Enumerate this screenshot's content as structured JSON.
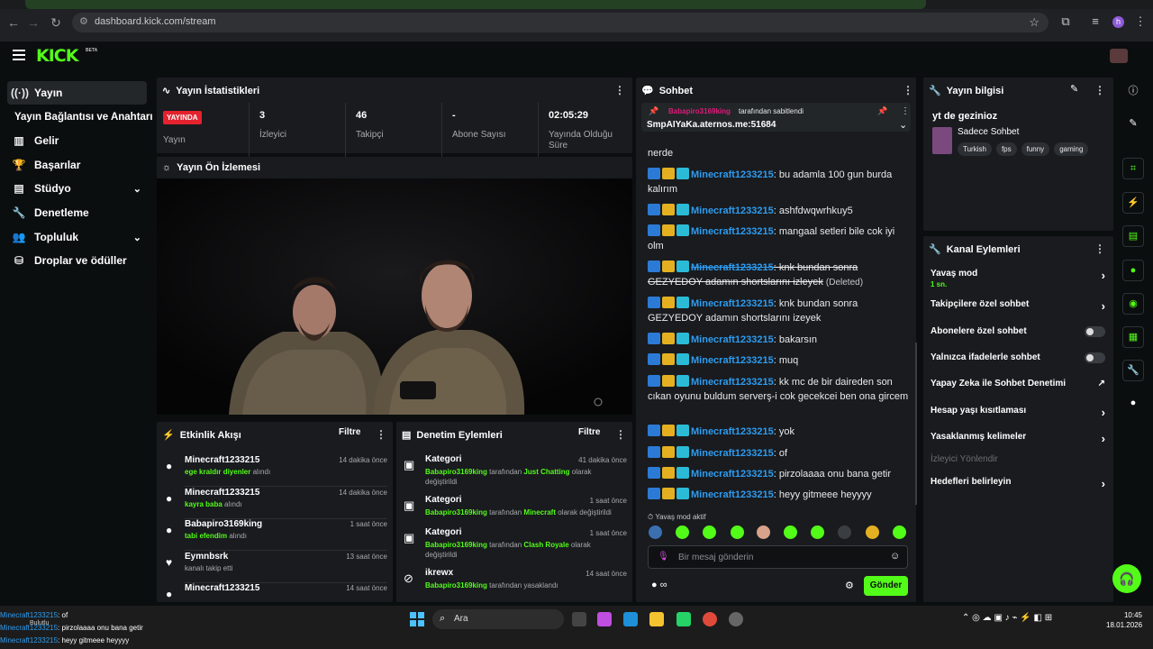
{
  "browser": {
    "url": "dashboard.kick.com/stream",
    "profile_initial": "h"
  },
  "app": {
    "logo": "KICK",
    "beta": "BETA"
  },
  "sidebar": {
    "items": [
      {
        "label": "Yayın",
        "icon": "broadcast-icon"
      },
      {
        "label": "Yayın Bağlantısı ve Anahtarı",
        "icon": ""
      },
      {
        "label": "Gelir",
        "icon": "chart-icon"
      },
      {
        "label": "Başarılar",
        "icon": "trophy-icon"
      },
      {
        "label": "Stüdyo",
        "icon": "studio-icon"
      },
      {
        "label": "Denetleme",
        "icon": "wrench-icon"
      },
      {
        "label": "Topluluk",
        "icon": "community-icon"
      },
      {
        "label": "Droplar ve ödüller",
        "icon": "drops-icon"
      }
    ]
  },
  "stats": {
    "title": "Yayın İstatistikleri",
    "live_badge": "YAYINDA",
    "live_label": "Yayın",
    "viewers_value": "3",
    "viewers_label": "İzleyici",
    "followers_value": "46",
    "followers_label": "Takipçi",
    "subs_value": "-",
    "subs_label": "Abone Sayısı",
    "duration_value": "02:05:29",
    "duration_label": "Yayında Olduğu Süre"
  },
  "preview": {
    "title": "Yayın Ön İzlemesi"
  },
  "activity": {
    "title": "Etkinlik Akışı",
    "filter": "Filtre",
    "rows": [
      {
        "name": "Minecraft1233215",
        "item": "ege kraldır diyenler",
        "suffix": "alındı",
        "time": "14 dakika önce"
      },
      {
        "name": "Minecraft1233215",
        "item": "kayra baba",
        "suffix": "alındı",
        "time": "14 dakika önce"
      },
      {
        "name": "Babapiro3169king",
        "item": "tabi efendim",
        "suffix": "alındı",
        "time": "1 saat önce"
      },
      {
        "name": "Eymnbsrk",
        "item": "",
        "suffix": "kanalı takip etti",
        "time": "13 saat önce"
      },
      {
        "name": "Minecraft1233215",
        "item": "",
        "suffix": "",
        "time": "14 saat önce"
      }
    ]
  },
  "moderation": {
    "title": "Denetim Eylemleri",
    "filter": "Filtre",
    "rows": [
      {
        "name": "Kategori",
        "user": "Babapiro3169king",
        "mid": "tarafından",
        "item": "Just Chatting",
        "end": "olarak değiştirildi",
        "time": "41 dakika önce"
      },
      {
        "name": "Kategori",
        "user": "Babapiro3169king",
        "mid": "tarafından",
        "item": "Minecraft",
        "end": "olarak değiştirildi",
        "time": "1 saat önce"
      },
      {
        "name": "Kategori",
        "user": "Babapiro3169king",
        "mid": "tarafından",
        "item": "Clash Royale",
        "end": "olarak değiştirildi",
        "time": "1 saat önce"
      },
      {
        "name": "ikrewx",
        "user": "Babapiro3169king",
        "mid": "tarafından yasaklandı",
        "item": "",
        "end": "",
        "time": "14 saat önce"
      }
    ]
  },
  "chat": {
    "title": "Sohbet",
    "pinned_user": "Babapiro3169king",
    "pinned_suffix": "tarafından sabitlendi",
    "pinned_text": "SmpAIYaKa.aternos.me:51684",
    "messages": [
      {
        "user": "",
        "text": "nerde",
        "deleted": false
      },
      {
        "user": "Minecraft1233215",
        "text": ": bu adamla 100 gun burda kalırım",
        "deleted": false
      },
      {
        "user": "Minecraft1233215",
        "text": ": ashfdwqwrhkuy5",
        "deleted": false
      },
      {
        "user": "Minecraft1233215",
        "text": ": mangaal setleri bile cok iyi olm",
        "deleted": false
      },
      {
        "user": "Minecraft1233215",
        "text": ": knk bundan sonra GEZYEDOY adamın shortslarını izleyek",
        "deleted": true,
        "deleted_label": "(Deleted)"
      },
      {
        "user": "Minecraft1233215",
        "text": ": knk bundan sonra GEZYEDOY adamın shortslarını izeyek",
        "deleted": false
      },
      {
        "user": "Minecraft1233215",
        "text": ": bakarsın",
        "deleted": false
      },
      {
        "user": "Minecraft1233215",
        "text": ": muq",
        "deleted": false
      },
      {
        "user": "Minecraft1233215",
        "text": ": kk mc de bir daireden son cıkan oyunu buldum serverş-i cok gecekcei ben ona gircem",
        "deleted": false
      },
      {
        "user": "Minecraft1233215",
        "text": ": yok",
        "deleted": false
      },
      {
        "user": "Minecraft1233215",
        "text": ": of",
        "deleted": false
      },
      {
        "user": "Minecraft1233215",
        "text": ": pirzolaaaa onu bana getir",
        "deleted": false
      },
      {
        "user": "Minecraft1233215",
        "text": ": heyy gitmeee heyyyy",
        "deleted": false
      }
    ],
    "slow_mode": "Yavaş mod aktif",
    "input_placeholder": "Bir mesaj gönderin",
    "send": "Gönder",
    "points": "∞"
  },
  "info": {
    "title": "Yayın bilgisi",
    "stream_title": "yt de gezinioz",
    "category": "Sadece Sohbet",
    "tags": [
      "Turkish",
      "fps",
      "funny",
      "gaming"
    ]
  },
  "channel_actions": {
    "title": "Kanal Eylemleri",
    "slow_mode": "Yavaş mod",
    "slow_mode_value": "1 sn.",
    "followers_only": "Takipçilere özel sohbet",
    "subs_only": "Abonelere özel sohbet",
    "emotes_only": "Yalnızca ifadelerle sohbet",
    "ai_moderation": "Yapay Zeka ile Sohbet Denetimi",
    "account_age": "Hesap yaşı kısıtlaması",
    "banned_words": "Yasaklanmış kelimeler",
    "viewer_redirect": "İzleyici Yönlendir",
    "set_goals": "Hedefleri belirleyin"
  },
  "taskbar": {
    "search": "Ara",
    "time": "10:45",
    "date": "18.01.2026",
    "ticker": [
      {
        "user": "Minecraft1233215",
        "text": ": of"
      },
      {
        "user": "Minecraft1233215",
        "text": ": pirzolaaaa onu bana getir"
      },
      {
        "user": "Minecraft1233215",
        "text": ": heyy gitmeee heyyyy"
      }
    ],
    "weather": "Bulutlu"
  },
  "colors": {
    "brand": "#53fc18",
    "live": "#e4222e",
    "username": "#2d9cf0",
    "panel": "#191b1f"
  }
}
